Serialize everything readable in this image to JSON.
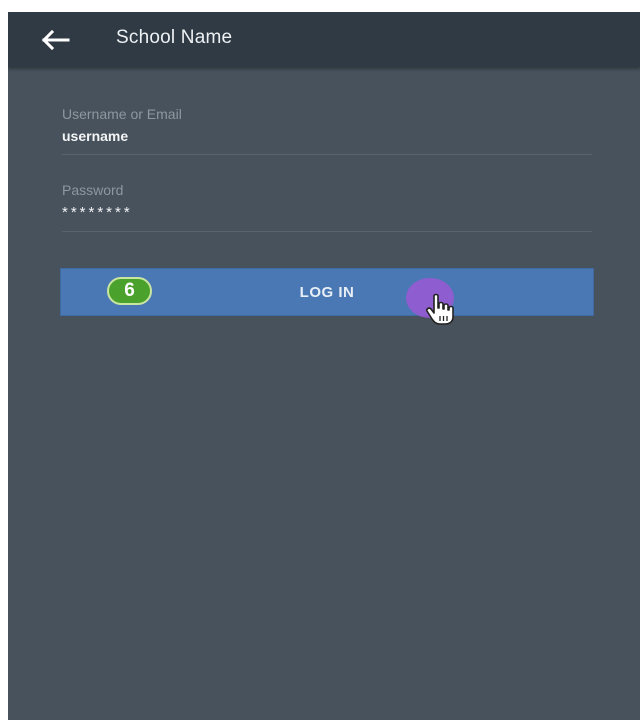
{
  "appbar": {
    "title": "School Name",
    "back_icon": "arrow-left-icon"
  },
  "form": {
    "username": {
      "label": "Username or Email",
      "value": "username"
    },
    "password": {
      "label": "Password",
      "value": "********"
    },
    "login_button": {
      "label": "LOG IN"
    }
  },
  "overlay": {
    "step_number": "6",
    "pointer_icon": "hand-pointer-icon",
    "tap_indicator_color": "#965ad2"
  },
  "colors": {
    "appbar_bg": "#2f3a44",
    "screen_bg": "#48525c",
    "button_bg": "#4a78b4",
    "badge_bg": "#4aa12c"
  }
}
